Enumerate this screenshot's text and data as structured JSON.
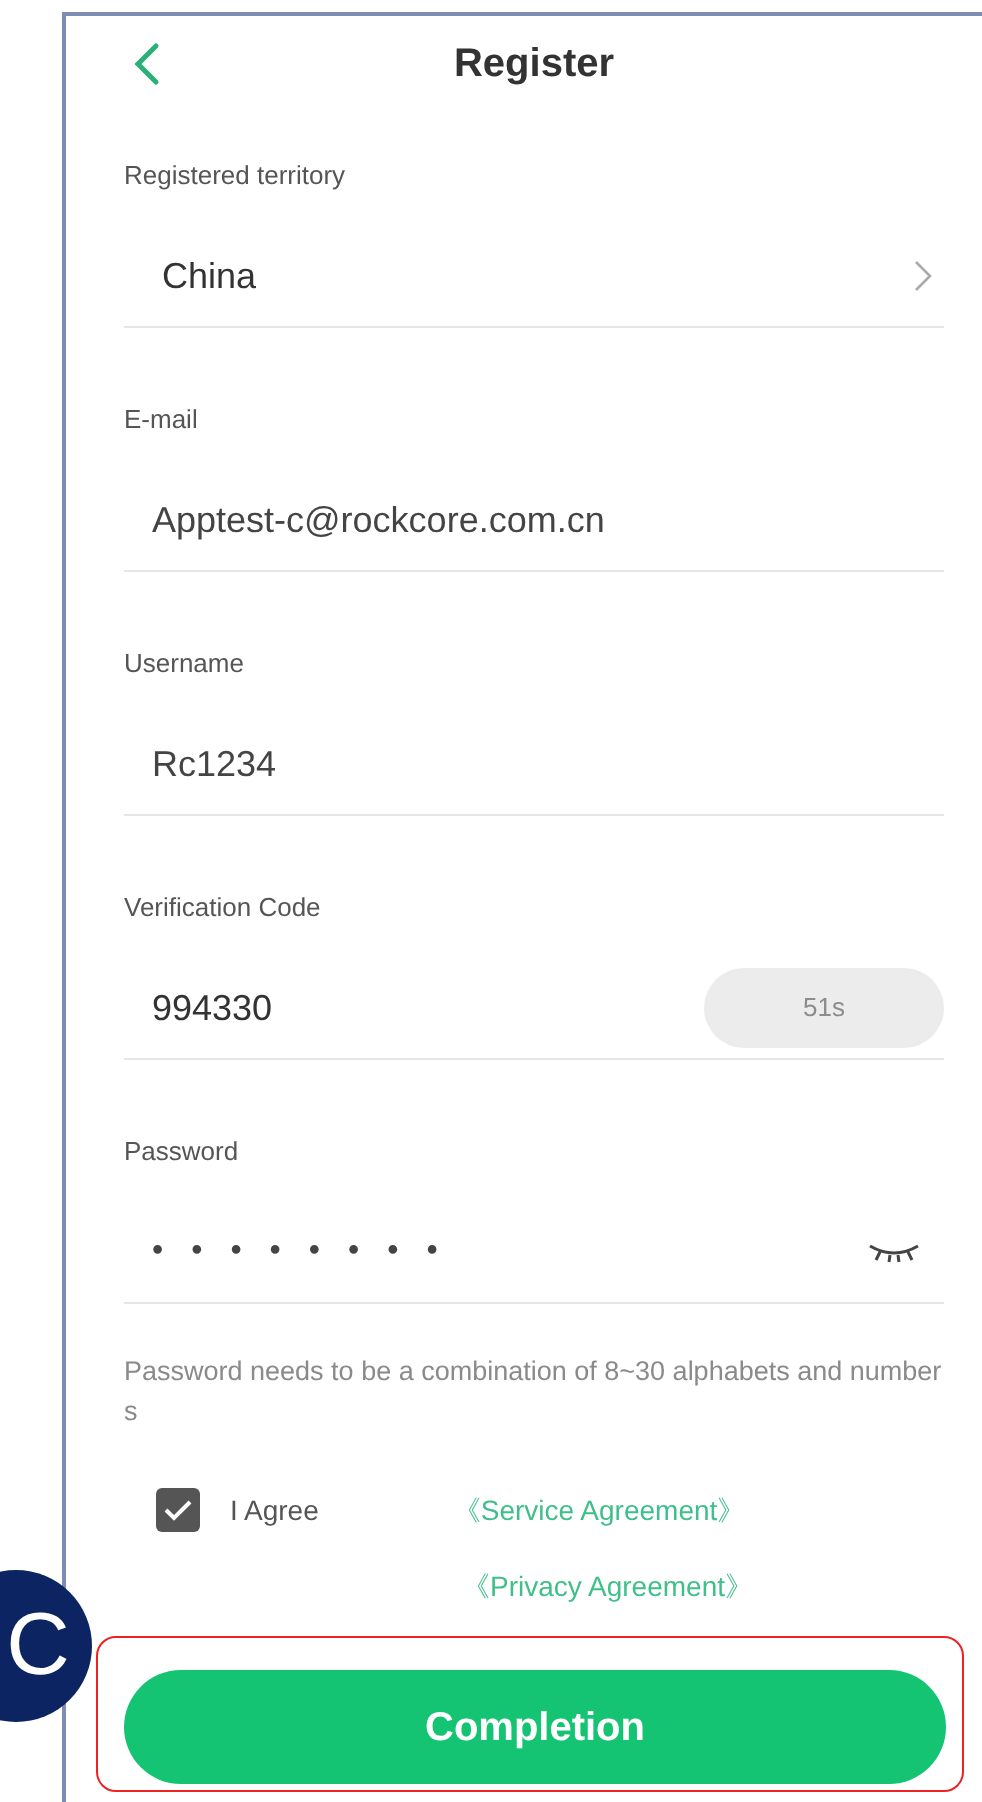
{
  "header": {
    "title": "Register"
  },
  "fields": [
    {
      "kind": "select",
      "label": "Registered territory",
      "value": "China"
    },
    {
      "kind": "text",
      "label": "E-mail",
      "value": "Apptest-c@rockcore.com.cn"
    },
    {
      "kind": "text",
      "label": "Username",
      "value": "Rc1234"
    },
    {
      "kind": "code",
      "label": "Verification Code",
      "value": "994330",
      "button": {
        "label": "51s",
        "disabled": true
      }
    },
    {
      "kind": "password",
      "label": "Password",
      "value": "••••••••",
      "visible": false
    }
  ],
  "hint": "Password needs to be a combination of 8~30 alphabets and numbers",
  "agreement": {
    "checked": true,
    "label": "I Agree",
    "links": [
      "《Service Agreement》",
      "《Privacy Agreement》"
    ]
  },
  "submit": {
    "label": "Completion"
  },
  "callout": {
    "label": "C"
  }
}
